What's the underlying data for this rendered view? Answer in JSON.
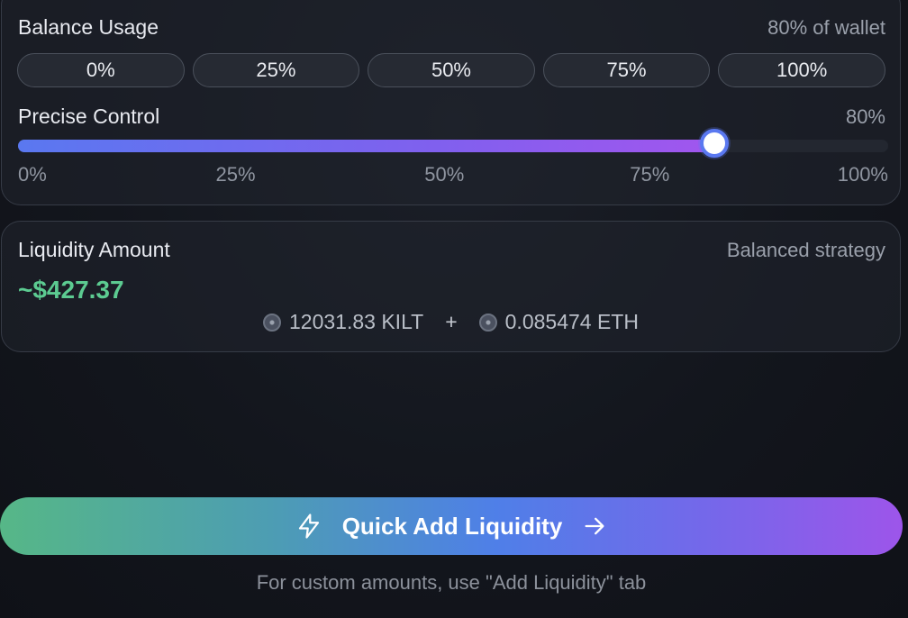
{
  "balance_usage": {
    "title": "Balance Usage",
    "wallet_label": "80% of wallet",
    "buttons": [
      "0%",
      "25%",
      "50%",
      "75%",
      "100%"
    ]
  },
  "precise_control": {
    "title": "Precise Control",
    "value_label": "80%",
    "value": 80,
    "ticks": [
      "0%",
      "25%",
      "50%",
      "75%",
      "100%"
    ]
  },
  "liquidity": {
    "title": "Liquidity Amount",
    "strategy": "Balanced strategy",
    "amount": "~$427.37",
    "token_a": "12031.83 KILT",
    "plus": "+",
    "token_b": "0.085474 ETH"
  },
  "cta": {
    "label": "Quick Add Liquidity",
    "icon_left": "lightning-icon",
    "icon_right": "arrow-right-icon"
  },
  "hint": "For custom amounts, use \"Add Liquidity\" tab",
  "colors": {
    "accent_green": "#5ccb91",
    "slider_start": "#5a78f0",
    "slider_end": "#a156ee"
  }
}
